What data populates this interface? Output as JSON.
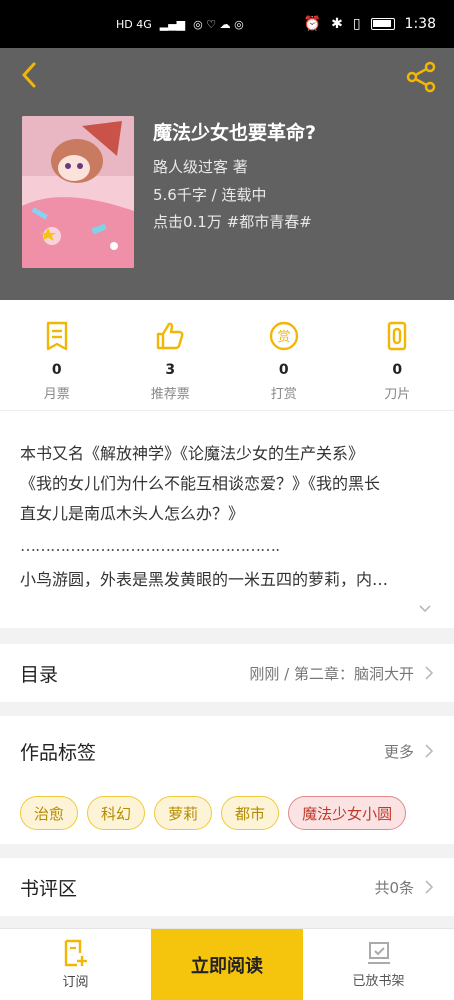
{
  "status": {
    "left_text": "HD 4G",
    "time": "1:38"
  },
  "book": {
    "title": "魔法少女也要革命?",
    "author": "路人级过客  著",
    "words_status": "5.6千字 / 连载中",
    "clicks_tag": "点击0.1万  #都市青春#"
  },
  "stats": [
    {
      "count": "0",
      "label": "月票",
      "icon": "ticket-icon"
    },
    {
      "count": "3",
      "label": "推荐票",
      "icon": "thumbs-up-icon"
    },
    {
      "count": "0",
      "label": "打赏",
      "icon": "reward-icon"
    },
    {
      "count": "0",
      "label": "刀片",
      "icon": "blade-icon"
    }
  ],
  "intro": {
    "line1": "本书又名《解放神学》《论魔法少女的生产关系》",
    "line2": "《我的女儿们为什么不能互相谈恋爱？》《我的黑长",
    "line3": "直女儿是南瓜木头人怎么办？》",
    "dots": "……………………………………………………………",
    "summary": "小鸟游圆，外表是黑发黄眼的一米五四的萝莉，内…"
  },
  "toc": {
    "title": "目录",
    "latest": "刚刚 / 第二章：脑洞大开"
  },
  "tags_section": {
    "title": "作品标签",
    "more": "更多",
    "tags": [
      "治愈",
      "科幻",
      "萝莉",
      "都市"
    ],
    "special_tag": "魔法少女小圆"
  },
  "reviews": {
    "title": "书评区",
    "count": "共0条"
  },
  "bottom_bar": {
    "subscribe": "订阅",
    "read_now": "立即阅读",
    "shelf": "已放书架"
  },
  "colors": {
    "accent": "#f5c40c",
    "header_bg": "#616161",
    "icon_yellow": "#f2b705"
  }
}
